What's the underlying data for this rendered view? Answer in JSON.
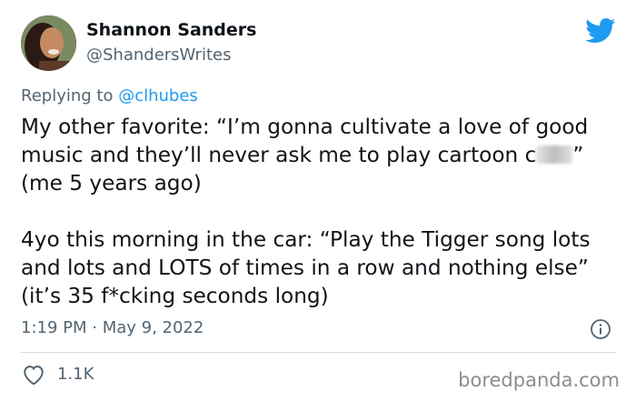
{
  "author": {
    "display_name": "Shannon Sanders",
    "handle": "@ShandersWrites"
  },
  "reply": {
    "prefix": "Replying to",
    "handle": "@clhubes"
  },
  "tweet": {
    "para1_before_censor": "My other favorite: “I’m gonna cultivate a love of good music and they’ll never ask me to play cartoon c",
    "para1_after_censor": "” (me 5 years ago)",
    "para2": "4yo this morning in the car: “Play the Tigger song lots and lots and LOTS of times in a row and nothing else” (it’s 35 f*cking seconds long)"
  },
  "meta": {
    "timestamp": "1:19 PM · May 9, 2022"
  },
  "stats": {
    "likes": "1.1K"
  },
  "watermark": "boredpanda.com",
  "colors": {
    "twitter_blue": "#1d9bf0",
    "secondary_text": "#536471",
    "primary_text": "#0f1419",
    "divider": "#cfd9de"
  },
  "icons": [
    "twitter-bird-icon",
    "info-icon",
    "heart-icon"
  ]
}
